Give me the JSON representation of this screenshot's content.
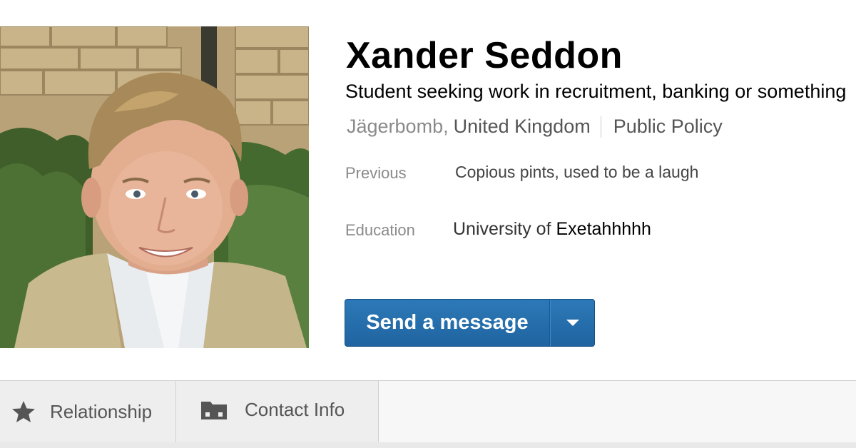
{
  "profile": {
    "name": "Xander Seddon",
    "headline": "Student seeking work in recruitment, banking or something",
    "locality": "Jägerbomb,",
    "country": "United Kingdom",
    "industry": "Public Policy",
    "previous_label": "Previous",
    "previous_value": "Copious pints, used to be a laugh",
    "education_label": "Education",
    "education_value_part1": "University of",
    "education_value_part2": "Exetahhhhh"
  },
  "actions": {
    "send_message_label": "Send a message",
    "dropdown_icon": "caret-down-icon"
  },
  "tabs": [
    {
      "label": "Relationship",
      "icon": "star-icon"
    },
    {
      "label": "Contact Info",
      "icon": "folder-icon"
    }
  ],
  "colors": {
    "button_blue": "#2d79b8",
    "label_gray": "#8a8a8a",
    "text_dark": "#333333"
  }
}
